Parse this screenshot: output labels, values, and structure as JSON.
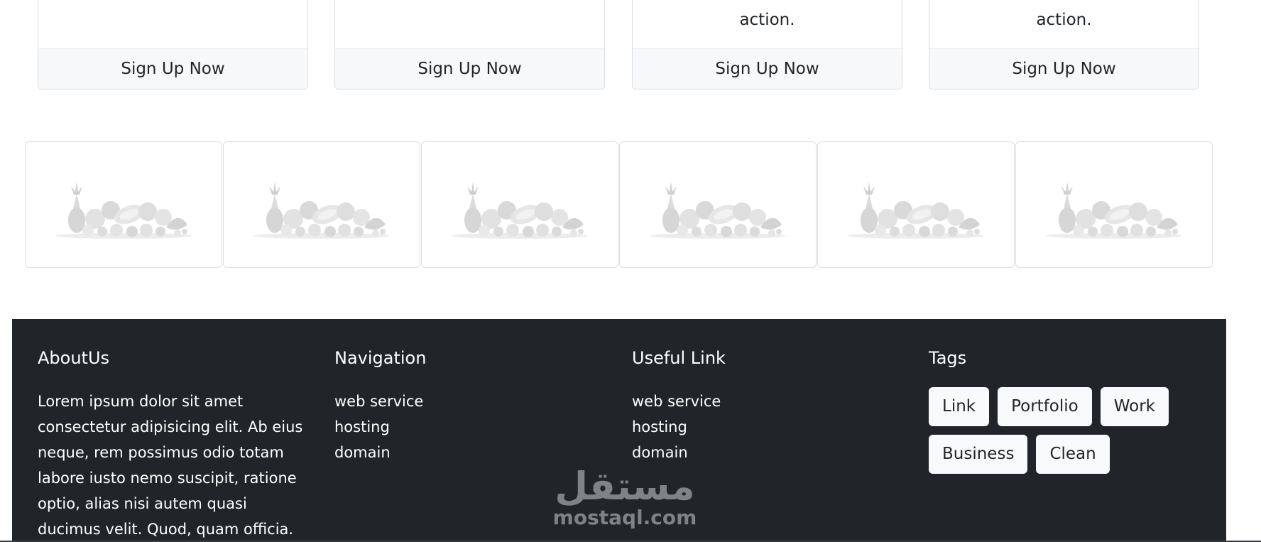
{
  "cards": [
    {
      "text_last": "",
      "button": "Sign Up Now"
    },
    {
      "text_last": "",
      "button": "Sign Up Now"
    },
    {
      "text_last": "action.",
      "button": "Sign Up Now"
    },
    {
      "text_last": "action.",
      "button": "Sign Up Now"
    }
  ],
  "gallery_count": 6,
  "footer": {
    "about": {
      "title": "AboutUs",
      "text": "Lorem ipsum dolor sit amet consectetur adipisicing elit. Ab eius neque, rem possimus odio totam labore iusto nemo suscipit, ratione optio, alias nisi autem quasi ducimus velit. Quod, quam officia."
    },
    "navigation": {
      "title": "Navigation",
      "links": [
        "web service",
        "hosting",
        "domain"
      ]
    },
    "useful": {
      "title": "Useful Link",
      "links": [
        "web service",
        "hosting",
        "domain"
      ]
    },
    "tags": {
      "title": "Tags",
      "items": [
        "Link",
        "Portfolio",
        "Work",
        "Business",
        "Clean"
      ]
    }
  },
  "watermark": {
    "arabic": "مستقل",
    "latin": "mostaql.com"
  },
  "colors": {
    "footer_bg": "#212529",
    "tag_bg": "#f8f9fa",
    "card_footer_bg": "#f7f8f9"
  }
}
